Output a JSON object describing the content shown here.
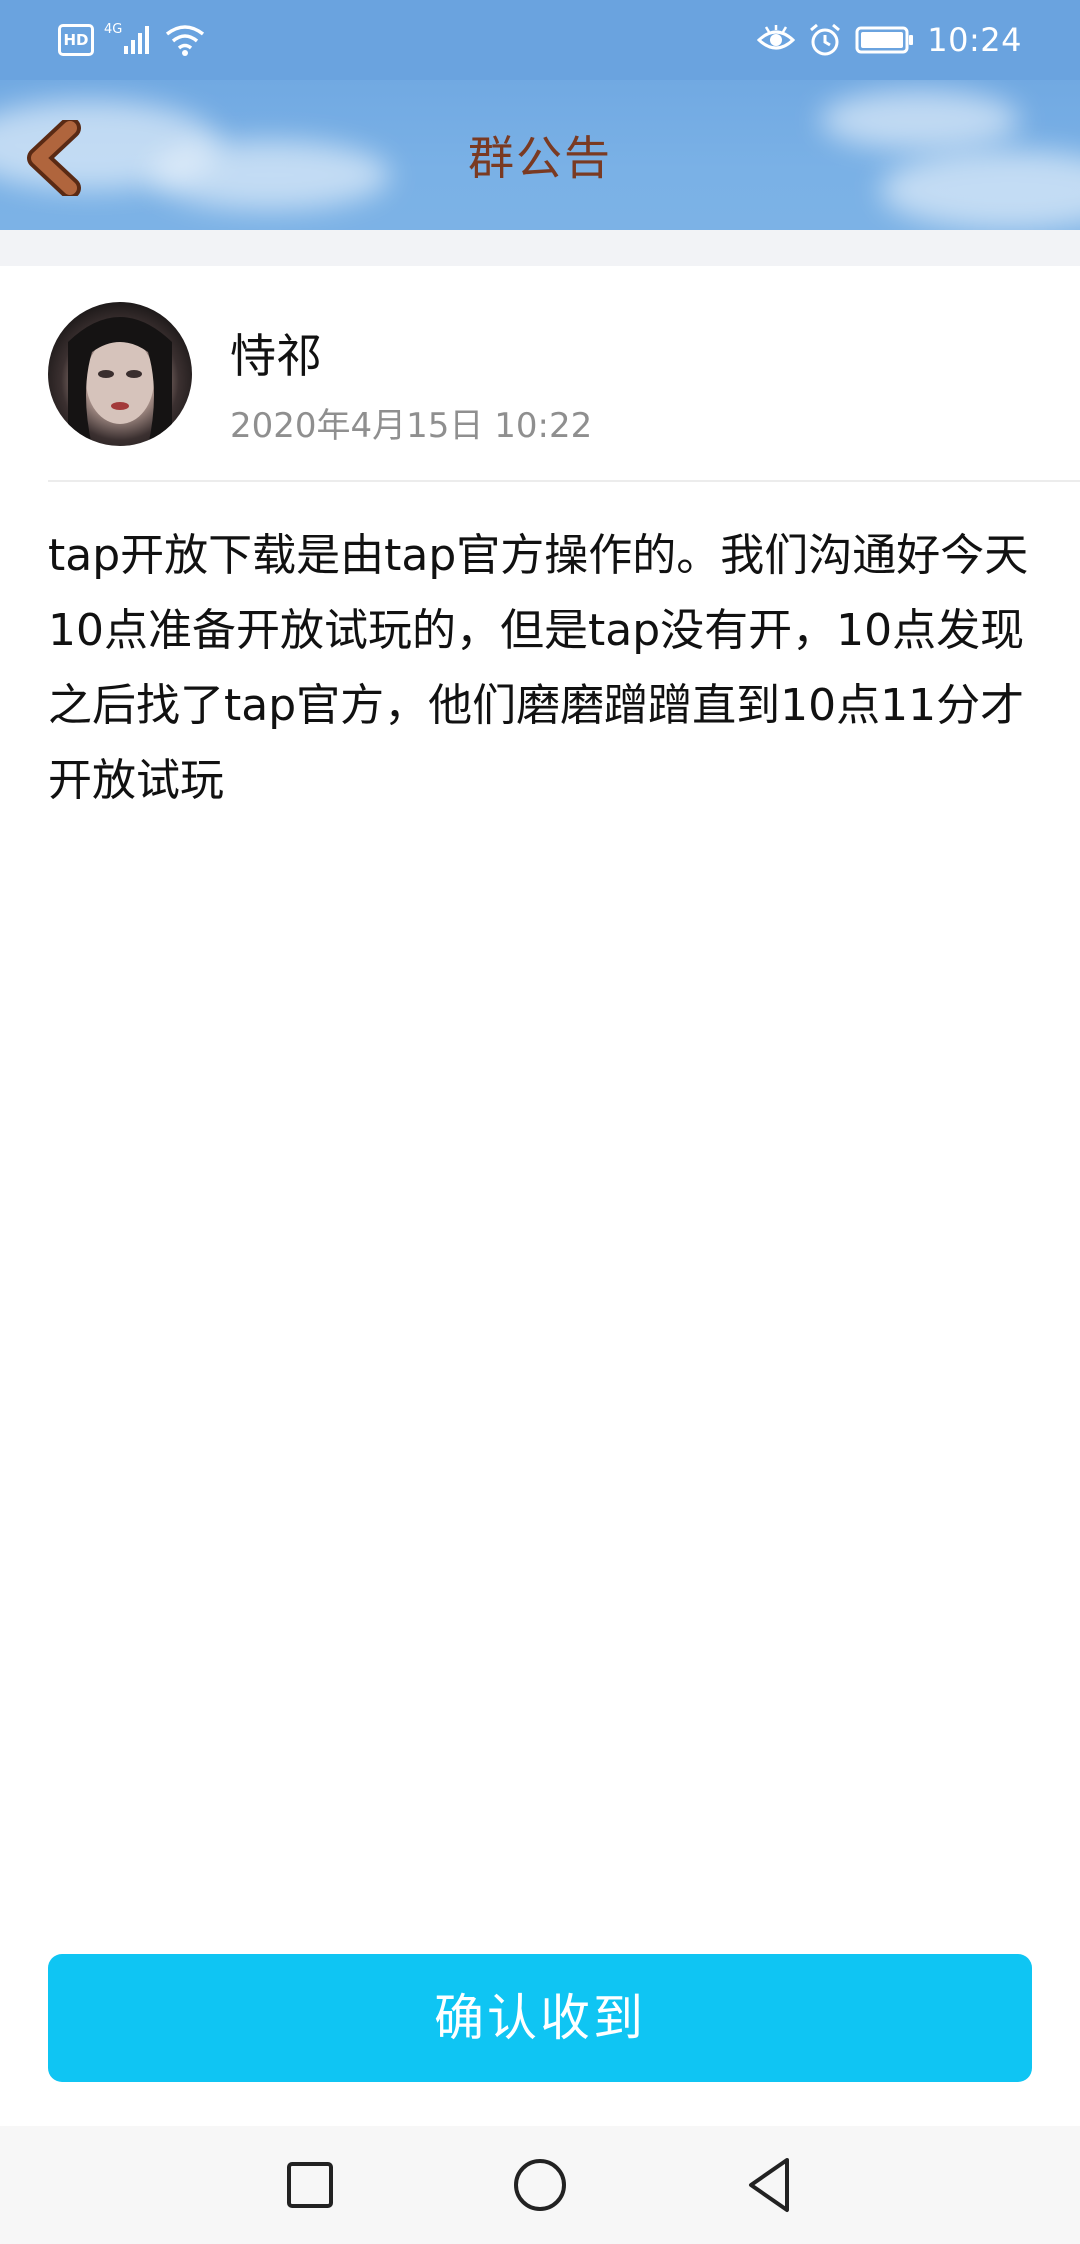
{
  "status_bar": {
    "network_badge": "HD",
    "signal_label": "4G",
    "time": "10:24",
    "icons": [
      "hd-icon",
      "signal-icon",
      "wifi-icon",
      "eye-comfort-icon",
      "alarm-icon",
      "battery-icon"
    ]
  },
  "header": {
    "title": "群公告",
    "back_icon": "back-arrow-icon",
    "title_color": "#7a3a22",
    "background_color": "#6aa3df"
  },
  "announcement": {
    "author": {
      "name": "恃祁",
      "avatar_icon": "avatar"
    },
    "timestamp": "2020年4月15日 10:22",
    "body": "tap开放下载是由tap官方操作的。我们沟通好今天10点准备开放试玩的，但是tap没有开，10点发现之后找了tap官方，他们磨磨蹭蹭直到10点11分才开放试玩"
  },
  "footer": {
    "confirm_label": "确认收到",
    "confirm_color": "#0fc5f3"
  },
  "system_nav": {
    "icons": [
      "recent-apps-icon",
      "home-icon",
      "back-icon"
    ]
  }
}
